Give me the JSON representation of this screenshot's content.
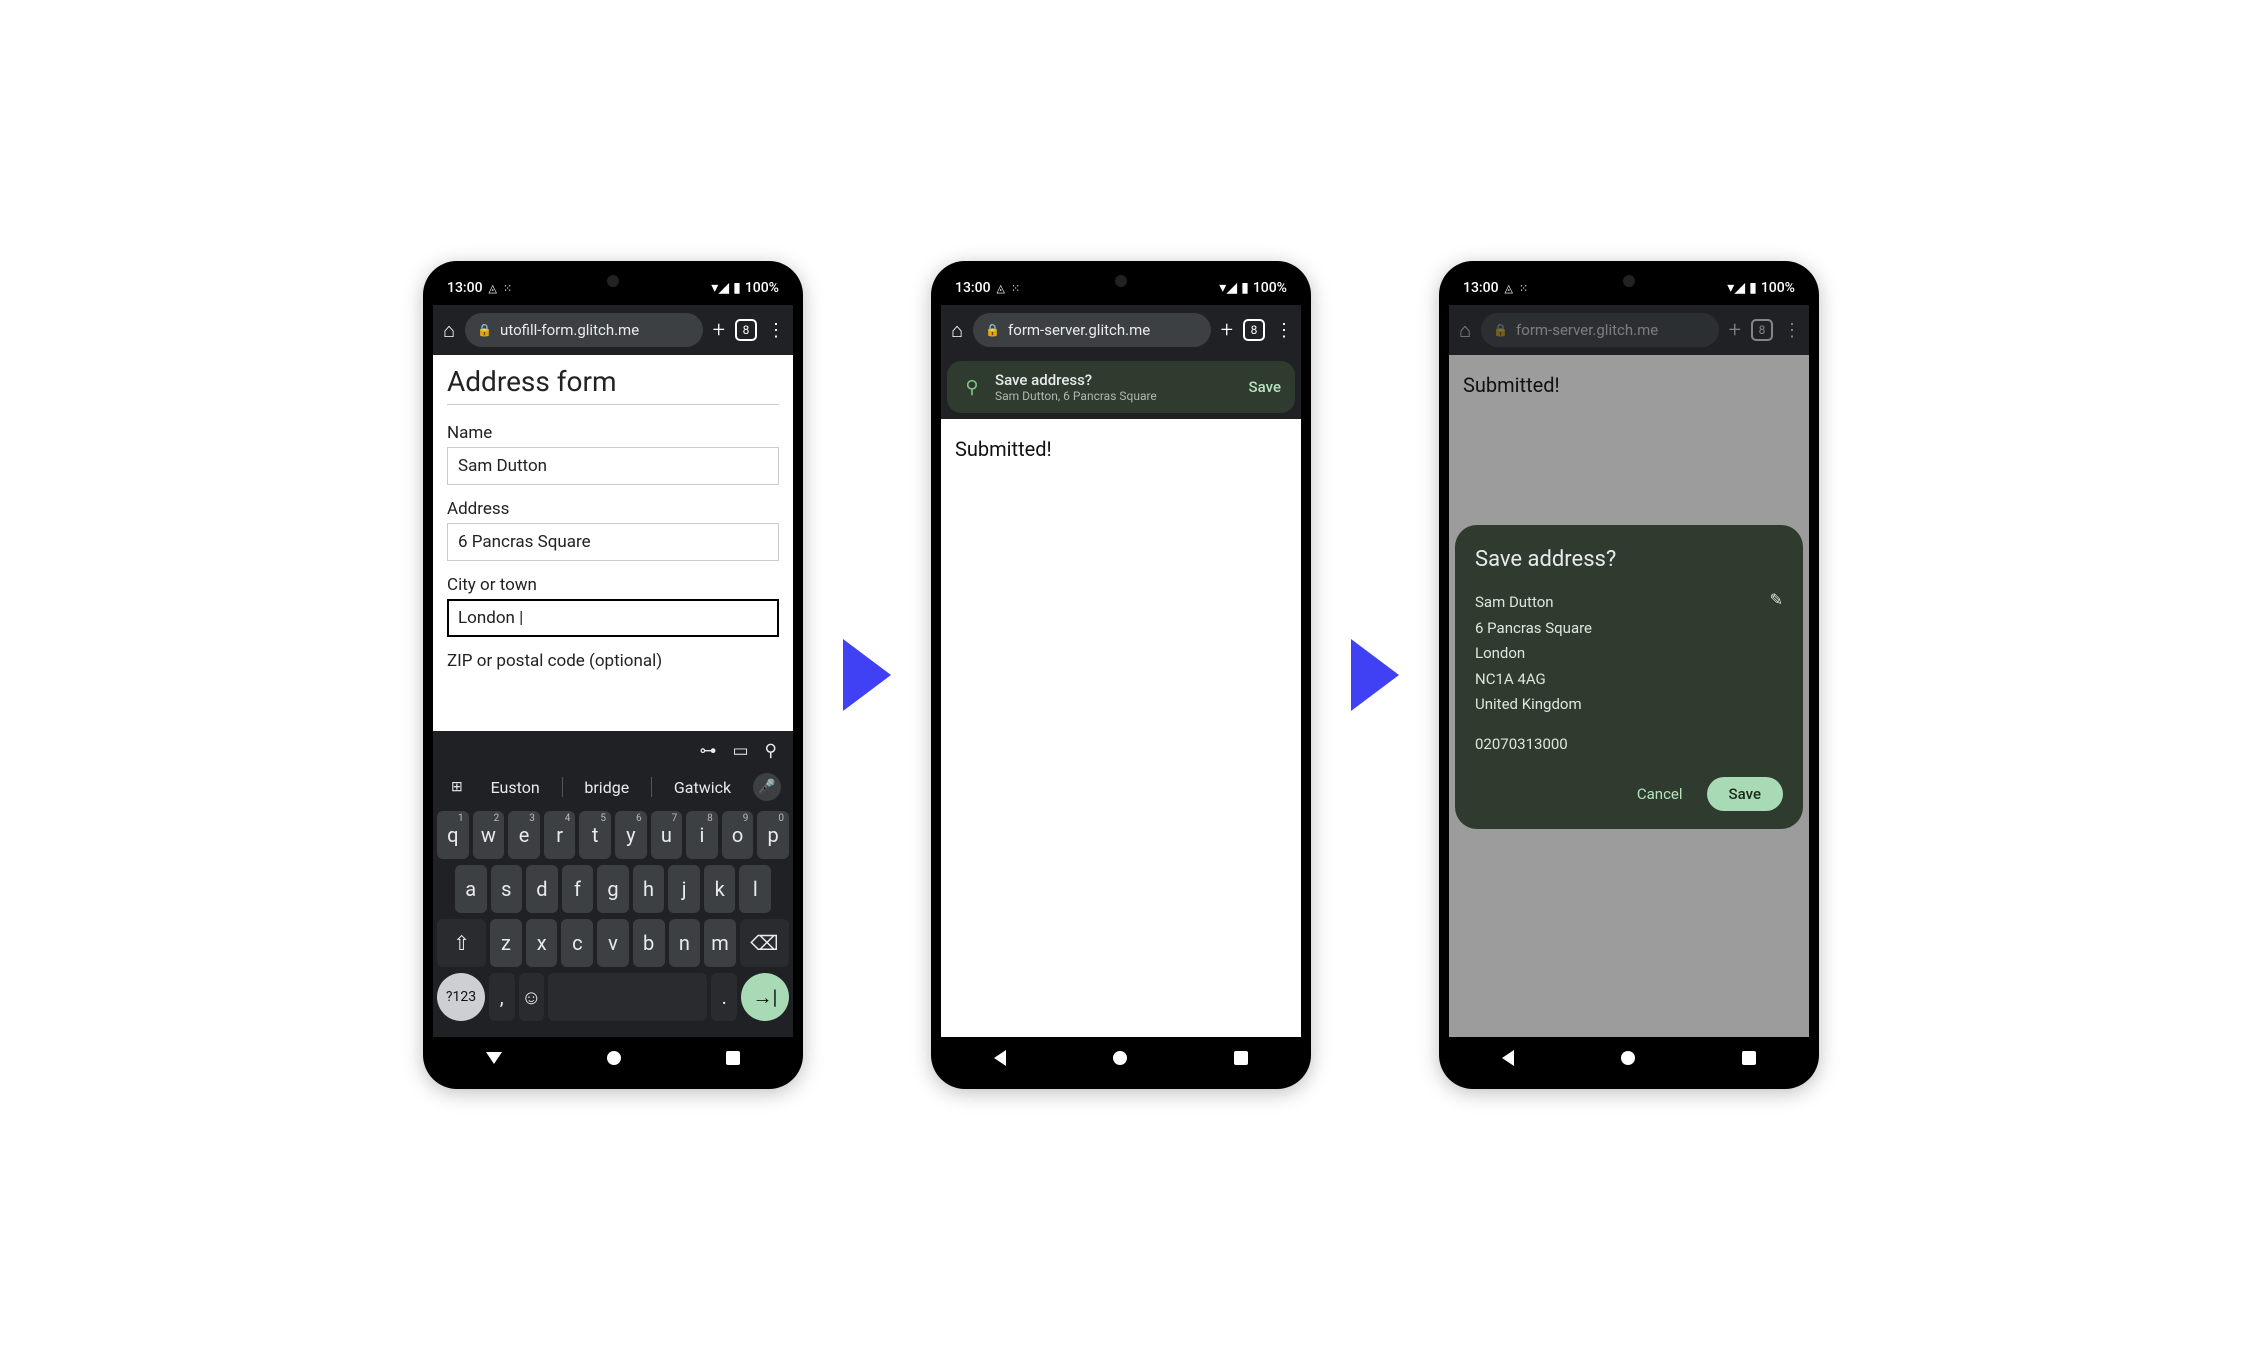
{
  "status": {
    "time": "13:00",
    "battery": "100%"
  },
  "phone1": {
    "url": "utofill-form.glitch.me",
    "tab_count": "8",
    "form_title": "Address form",
    "labels": {
      "name": "Name",
      "address": "Address",
      "city": "City or town",
      "zip": "ZIP or postal code (optional)"
    },
    "values": {
      "name": "Sam Dutton",
      "address": "6 Pancras Square",
      "city": "London"
    },
    "suggestions": [
      "Euston",
      "bridge",
      "Gatwick"
    ],
    "keys_row1": [
      {
        "c": "q",
        "s": "1"
      },
      {
        "c": "w",
        "s": "2"
      },
      {
        "c": "e",
        "s": "3"
      },
      {
        "c": "r",
        "s": "4"
      },
      {
        "c": "t",
        "s": "5"
      },
      {
        "c": "y",
        "s": "6"
      },
      {
        "c": "u",
        "s": "7"
      },
      {
        "c": "i",
        "s": "8"
      },
      {
        "c": "o",
        "s": "9"
      },
      {
        "c": "p",
        "s": "0"
      }
    ],
    "keys_row2": [
      "a",
      "s",
      "d",
      "f",
      "g",
      "h",
      "j",
      "k",
      "l"
    ],
    "keys_row3": [
      "z",
      "x",
      "c",
      "v",
      "b",
      "n",
      "m"
    ],
    "sym_key": "?123"
  },
  "phone2": {
    "url": "form-server.glitch.me",
    "tab_count": "8",
    "snack_title": "Save address?",
    "snack_sub": "Sam Dutton, 6 Pancras Square",
    "snack_action": "Save",
    "page_text": "Submitted!"
  },
  "phone3": {
    "url": "form-server.glitch.me",
    "tab_count": "8",
    "page_text": "Submitted!",
    "sheet_title": "Save address?",
    "lines": {
      "name": "Sam Dutton",
      "address": "6 Pancras Square",
      "city": "London",
      "zip": "NC1A 4AG",
      "country": "United Kingdom",
      "phone": "02070313000"
    },
    "cancel": "Cancel",
    "save": "Save"
  }
}
